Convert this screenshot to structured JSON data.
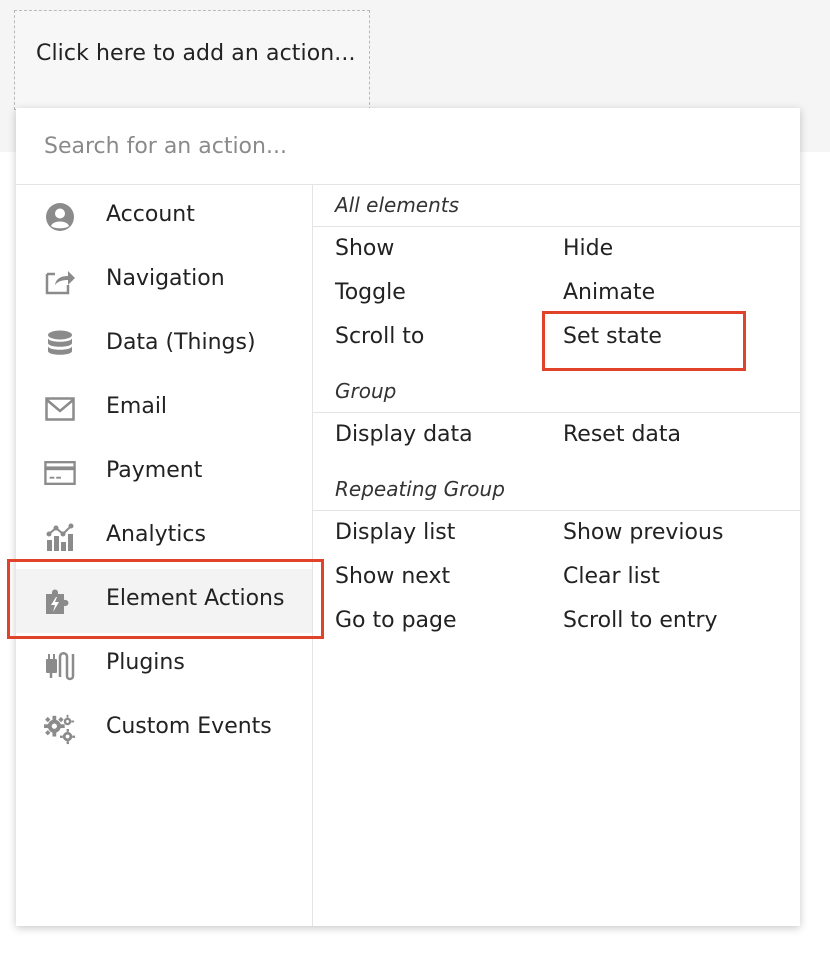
{
  "trigger": {
    "label": "Click here to add an action..."
  },
  "search": {
    "placeholder": "Search for an action..."
  },
  "categories": [
    {
      "label": "Account",
      "icon": "account-icon"
    },
    {
      "label": "Navigation",
      "icon": "share-icon"
    },
    {
      "label": "Data (Things)",
      "icon": "database-icon"
    },
    {
      "label": "Email",
      "icon": "envelope-icon"
    },
    {
      "label": "Payment",
      "icon": "credit-card-icon"
    },
    {
      "label": "Analytics",
      "icon": "analytics-icon"
    },
    {
      "label": "Element Actions",
      "icon": "puzzle-bolt-icon"
    },
    {
      "label": "Plugins",
      "icon": "plug-icon"
    },
    {
      "label": "Custom Events",
      "icon": "gears-icon"
    }
  ],
  "sections": {
    "all": {
      "title": "All elements",
      "actions": [
        "Show",
        "Hide",
        "Toggle",
        "Animate",
        "Scroll to",
        "Set state"
      ]
    },
    "group": {
      "title": "Group",
      "actions": [
        "Display data",
        "Reset data"
      ]
    },
    "rg": {
      "title": "Repeating Group",
      "actions": [
        "Display list",
        "Show previous",
        "Show next",
        "Clear list",
        "Go to page",
        "Scroll to entry"
      ]
    }
  },
  "colors": {
    "highlight": "#e1432a",
    "icon": "#7a7a7a"
  }
}
